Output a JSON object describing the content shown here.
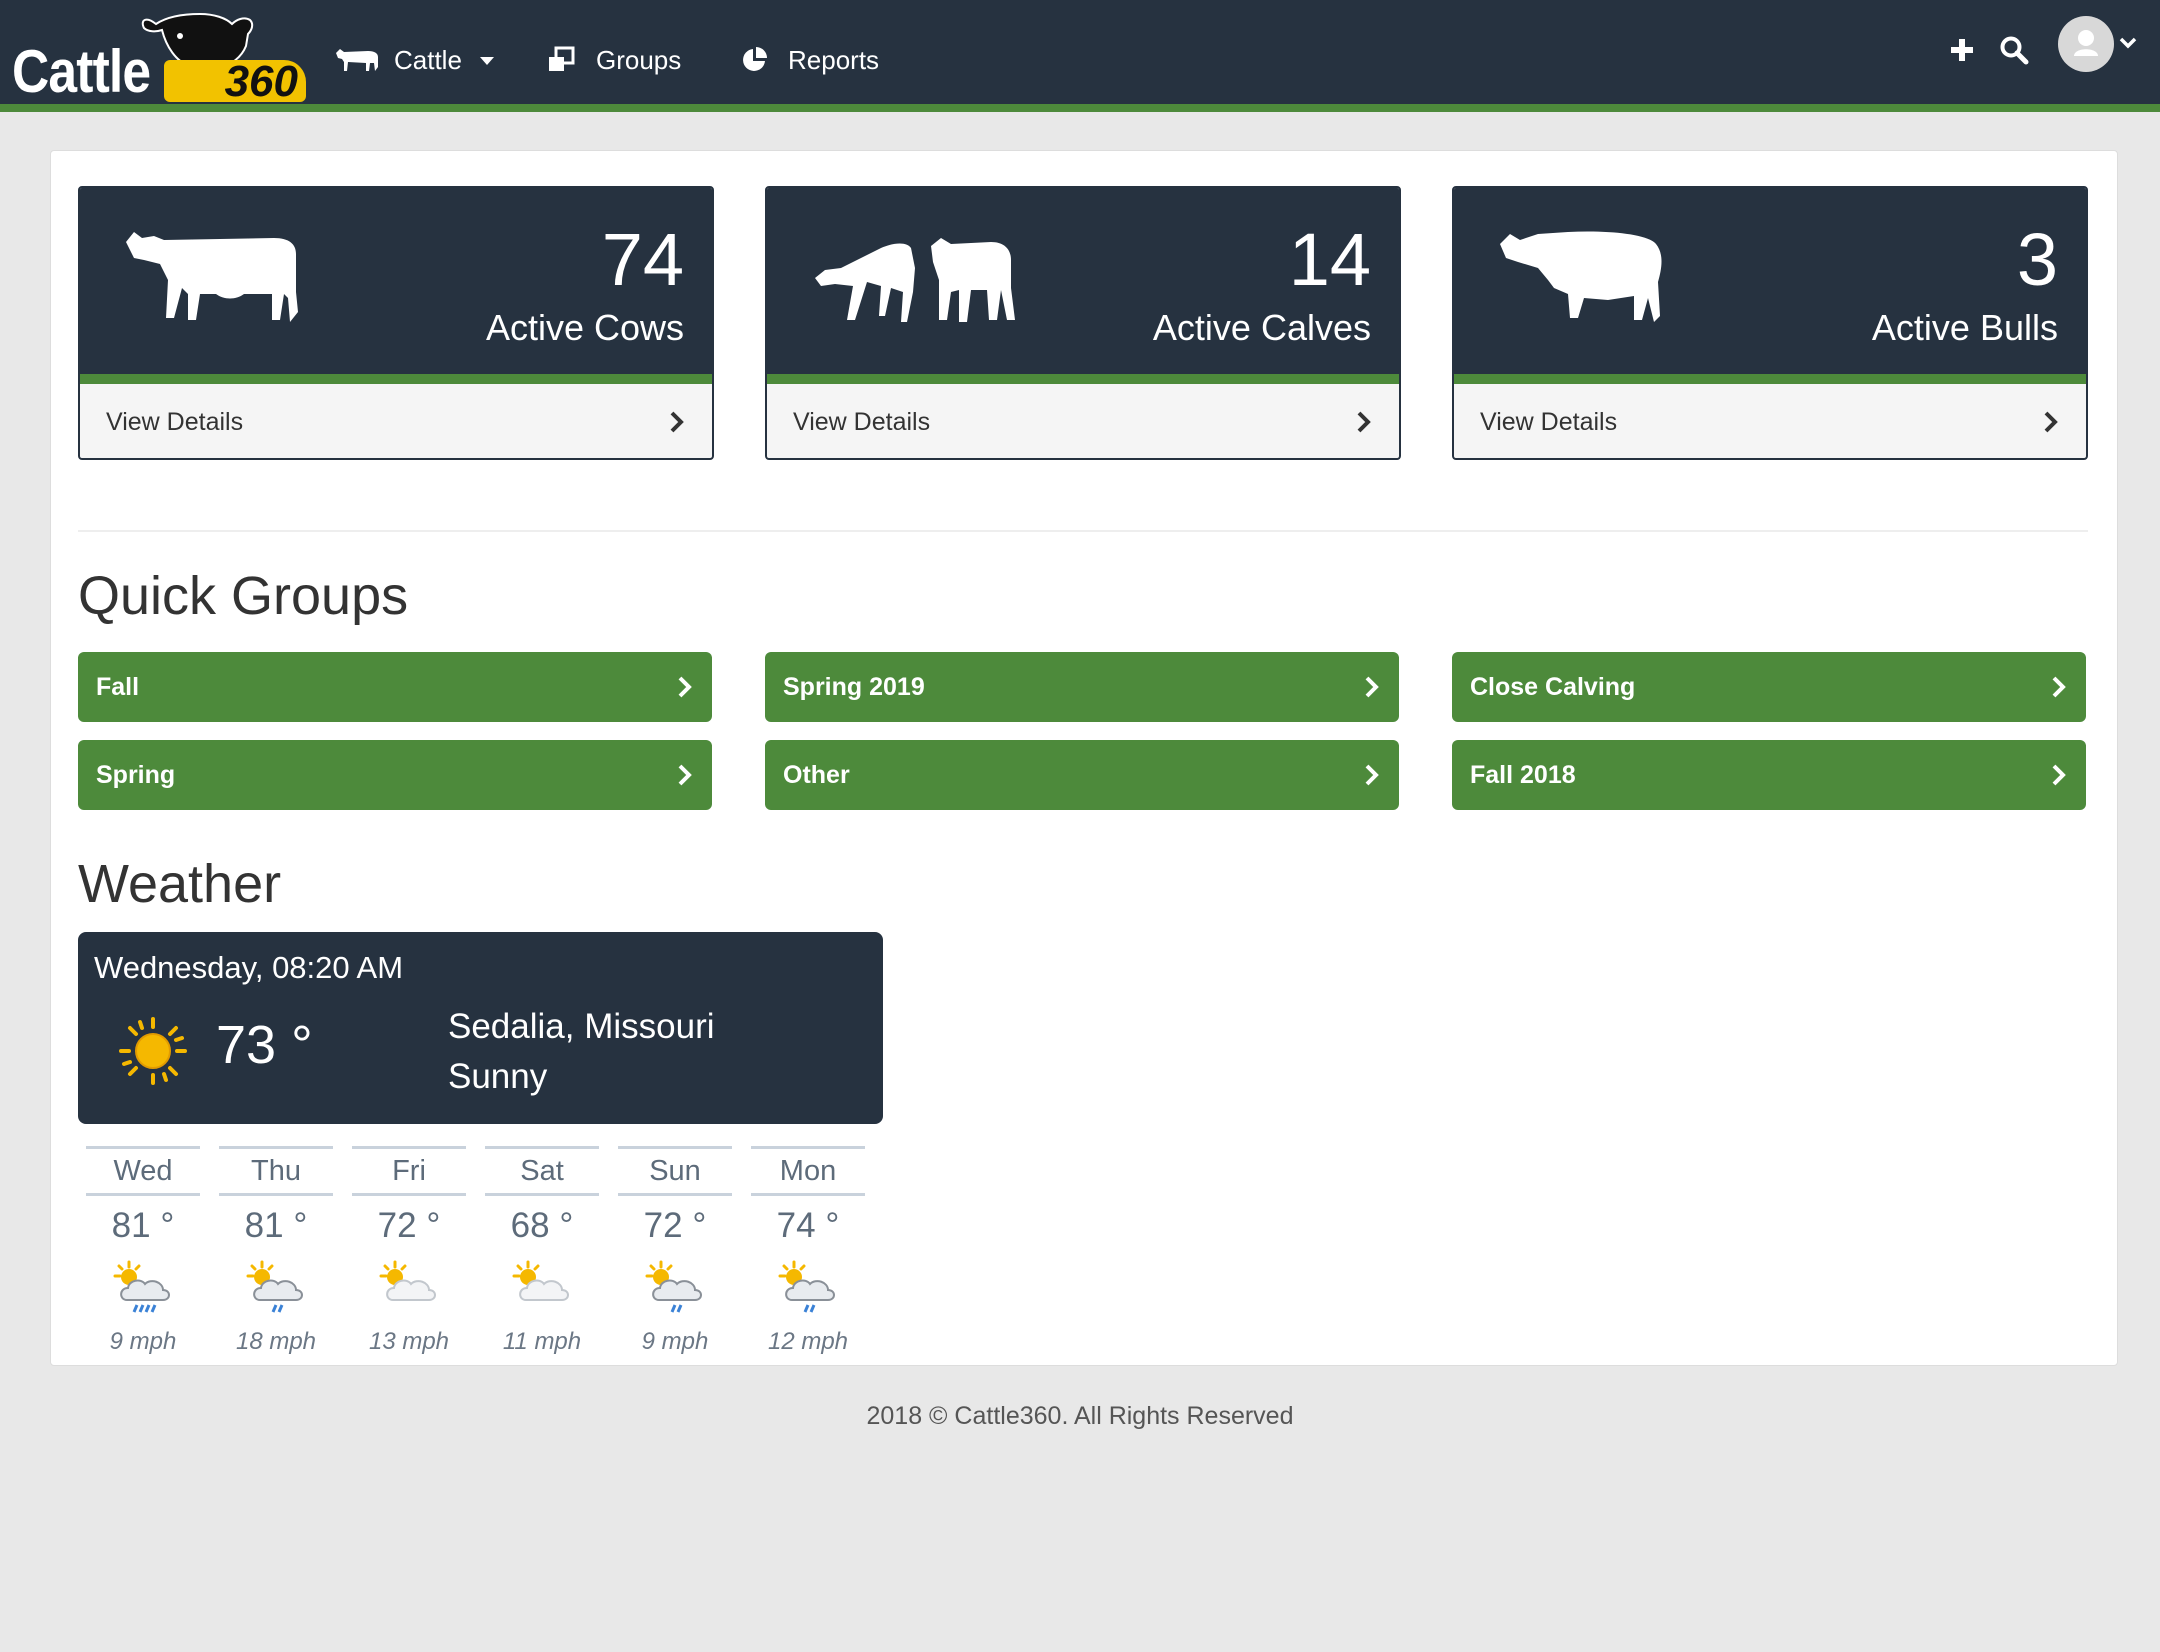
{
  "brand": {
    "word": "Cattle",
    "number": "360"
  },
  "nav": {
    "cattle_label": "Cattle",
    "groups_label": "Groups",
    "reports_label": "Reports"
  },
  "colors": {
    "navy": "#263240",
    "green": "#4d8a3b",
    "sun": "#f5b800"
  },
  "stats": [
    {
      "count": "74",
      "label": "Active Cows",
      "link": "View Details",
      "icon": "cow-icon"
    },
    {
      "count": "14",
      "label": "Active Calves",
      "link": "View Details",
      "icon": "calves-icon"
    },
    {
      "count": "3",
      "label": "Active Bulls",
      "link": "View Details",
      "icon": "bull-icon"
    }
  ],
  "quick_groups": {
    "title": "Quick Groups",
    "items": [
      "Fall",
      "Spring 2019",
      "Close Calving",
      "Spring",
      "Other",
      "Fall 2018"
    ]
  },
  "weather": {
    "title": "Weather",
    "datetime": "Wednesday, 08:20 AM",
    "temp": "73 °",
    "location": "Sedalia, Missouri",
    "condition": "Sunny",
    "forecast": [
      {
        "day": "Wed",
        "temp": "81 °",
        "wind": "9 mph",
        "icon": "rain-partly-cloudy-icon"
      },
      {
        "day": "Thu",
        "temp": "81 °",
        "wind": "18 mph",
        "icon": "rain-partly-cloudy-icon"
      },
      {
        "day": "Fri",
        "temp": "72 °",
        "wind": "13 mph",
        "icon": "partly-cloudy-icon"
      },
      {
        "day": "Sat",
        "temp": "68 °",
        "wind": "11 mph",
        "icon": "partly-cloudy-icon"
      },
      {
        "day": "Sun",
        "temp": "72 °",
        "wind": "9 mph",
        "icon": "rain-partly-cloudy-icon"
      },
      {
        "day": "Mon",
        "temp": "74 °",
        "wind": "12 mph",
        "icon": "rain-partly-cloudy-icon"
      }
    ]
  },
  "footer": "2018 © Cattle360. All Rights Reserved"
}
